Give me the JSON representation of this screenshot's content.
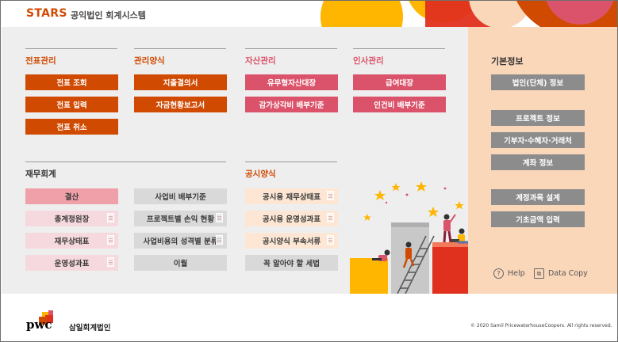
{
  "header": {
    "brand": "STARS",
    "subtitle": "공익법인 회계시스템"
  },
  "sections": {
    "voucher": {
      "title": "전표관리",
      "buttons": [
        "전표 조회",
        "전표 입력",
        "전표 취소"
      ]
    },
    "forms": {
      "title": "관리양식",
      "buttons": [
        "지출결의서",
        "자금현황보고서"
      ]
    },
    "assets": {
      "title": "자산관리",
      "buttons": [
        "유무형자산대장",
        "감가상각비 배부기준"
      ]
    },
    "hr": {
      "title": "인사관리",
      "buttons": [
        "급여대장",
        "인건비 배부기준"
      ]
    },
    "finance": {
      "title": "재무회계",
      "col1": [
        "결산",
        "총계정원장",
        "재무상태표",
        "운영성과표"
      ],
      "col2": [
        "사업비 배부기준",
        "프로젝트별 손익 현황",
        "사업비용의 성격별 분류",
        "이월"
      ]
    },
    "disclosure": {
      "title": "공시양식",
      "buttons": [
        "공시용 재무상태표",
        "공시용 운영성과표",
        "공시양식 부속서류",
        "꼭 알아야 할 세법"
      ]
    },
    "basic": {
      "title": "기본정보",
      "buttons": [
        "법인(단체) 정보",
        "프로젝트 정보",
        "기부자·수혜자·거래처",
        "계좌 정보",
        "계정과목 설계",
        "기초금액 입력"
      ]
    }
  },
  "tools": {
    "help": "Help",
    "data_copy": "Data Copy"
  },
  "footer": {
    "logo_text": "pwc",
    "firm": "삼일회계법인",
    "copyright": "© 2020 Samil PricewaterhouseCoopers. All rights reserved."
  },
  "colors": {
    "accent": "#d04a02",
    "rose": "#db536a",
    "side_bg": "#fbd7ba",
    "main_bg": "#eeeeee"
  }
}
